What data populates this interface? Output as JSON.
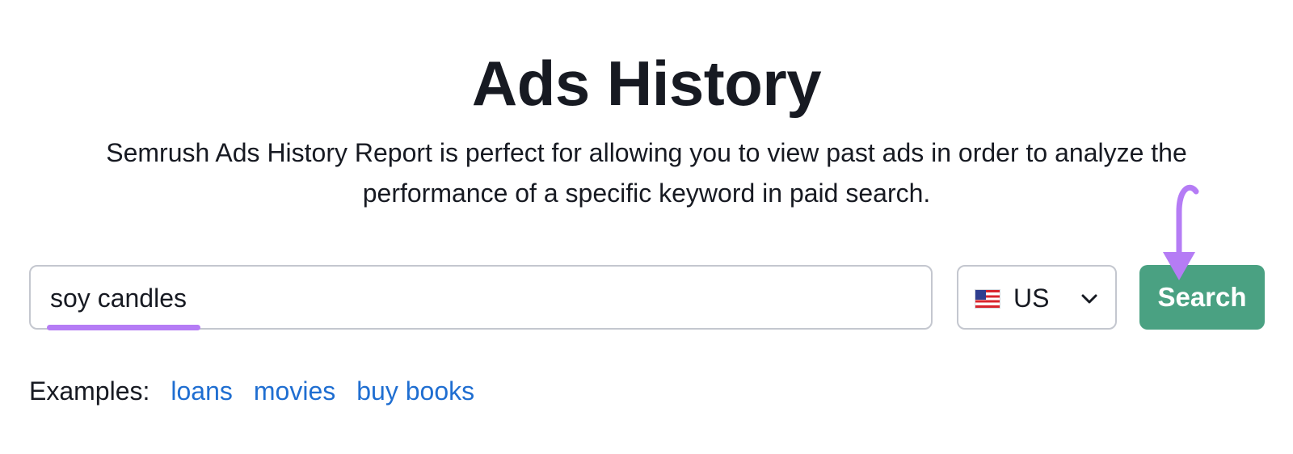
{
  "header": {
    "title": "Ads History",
    "description": "Semrush Ads History Report is perfect for allowing you to view past ads in order to analyze the performance of a specific keyword in paid search."
  },
  "search": {
    "value": "soy candles",
    "button_label": "Search"
  },
  "country": {
    "selected": "US",
    "flag_icon": "us-flag-icon"
  },
  "examples": {
    "label": "Examples:",
    "items": [
      "loans",
      "movies",
      "buy books"
    ]
  },
  "colors": {
    "search_button": "#4aa182",
    "annotation": "#b57cf5",
    "link": "#1f6ed1"
  }
}
